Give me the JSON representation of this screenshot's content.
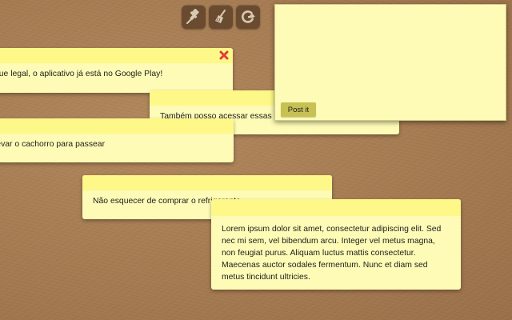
{
  "toolbar": {
    "buttons": [
      {
        "name": "pin-button",
        "icon": "pin-icon"
      },
      {
        "name": "clear-button",
        "icon": "broom-icon"
      },
      {
        "name": "logout-button",
        "icon": "refresh-icon"
      }
    ]
  },
  "notes": [
    {
      "text": "que legal, o aplicativo já está no Google Play!",
      "closable": true,
      "close_color": "#e23b3b"
    },
    {
      "text": "Também posso acessar essas notas no celular"
    },
    {
      "text": "levar o cachorro para passear"
    },
    {
      "text": "Não esquecer de comprar o refrigerante"
    },
    {
      "text": "Lorem ipsum dolor sit amet, consectetur adipiscing elit. Sed nec mi sem, vel bibendum arcu. Integer vel metus magna, non feugiat purus. Aliquam luctus mattis consectetur. Maecenas auctor sodales fermentum. Nunc et diam sed metus tincidunt ultricies."
    }
  ],
  "new_note": {
    "value": "",
    "submit_label": "Post it"
  },
  "colors": {
    "note_body": "#fdfbb5",
    "note_header": "#fdf887",
    "board": "#a47a51",
    "button": "#c7c154",
    "toolbar": "#6a4b30"
  }
}
